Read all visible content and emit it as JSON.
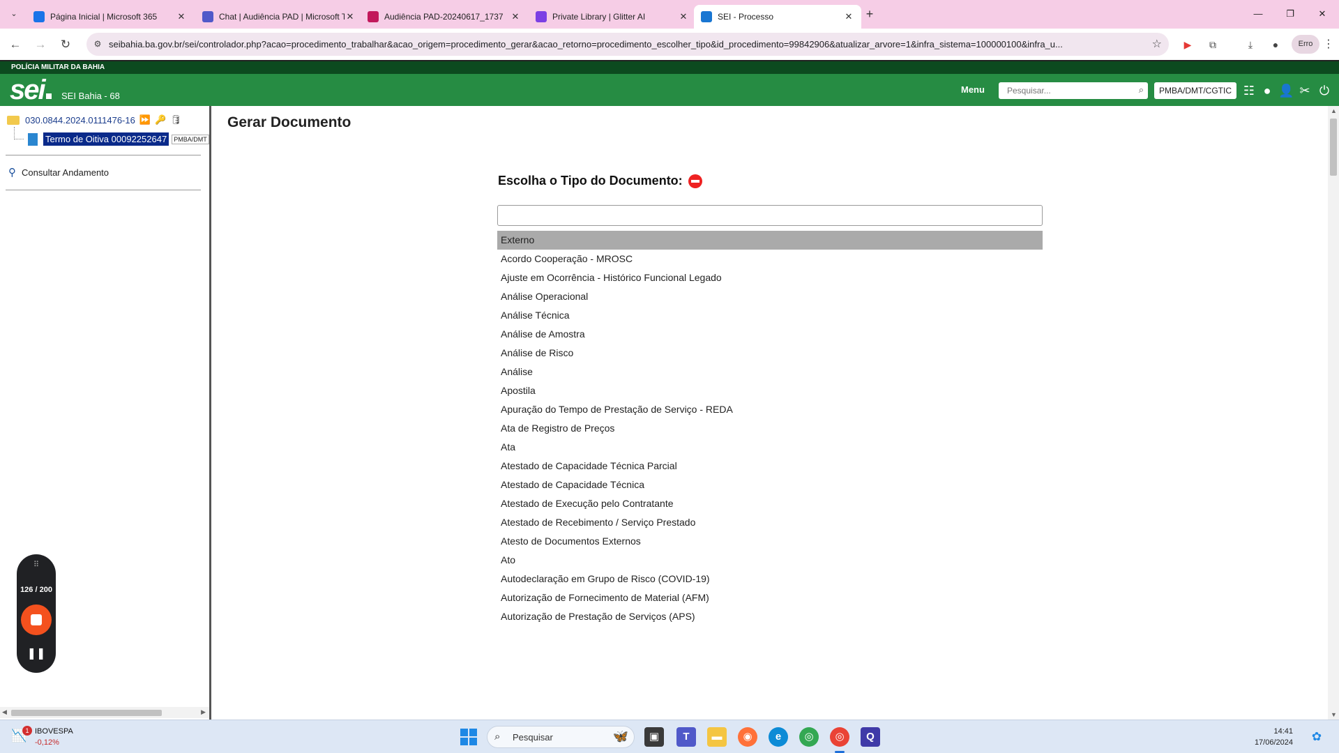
{
  "browser": {
    "tabs": [
      {
        "title": "Página Inicial | Microsoft 365",
        "color": "#1a73e8"
      },
      {
        "title": "Chat | Audiência PAD | Microsoft Teams",
        "color": "#5059c9"
      },
      {
        "title": "Audiência PAD-20240617_1737",
        "color": "#c2185b"
      },
      {
        "title": "Private Library | Glitter AI",
        "color": "#7b3fe4"
      },
      {
        "title": "SEI - Processo",
        "color": "#1976d2"
      }
    ],
    "url": "seibahia.ba.gov.br/sei/controlador.php?acao=procedimento_trabalhar&acao_origem=procedimento_gerar&acao_retorno=procedimento_escolher_tipo&id_procedimento=99842906&atualizar_arvore=1&infra_sistema=100000100&infra_u...",
    "profile_label": "Erro"
  },
  "sei": {
    "org": "POLÍCIA MILITAR DA BAHIA",
    "logo": "sei",
    "instance": "SEI Bahia - 68",
    "menu_label": "Menu",
    "search_placeholder": "Pesquisar...",
    "unit": "PMBA/DMT/CGTIC"
  },
  "tree": {
    "process_number": "030.0844.2024.0111476-16",
    "document_name": "Termo de Oitiva 00092252647",
    "document_unit": "PMBA/DMT",
    "consult_label": "Consultar Andamento"
  },
  "recorder": {
    "count": "126 / 200"
  },
  "main": {
    "page_title": "Gerar Documento",
    "choose_label": "Escolha o Tipo do Documento:",
    "filter_value": "",
    "document_types": [
      "Externo",
      "Acordo Cooperação - MROSC",
      "Ajuste em Ocorrência - Histórico Funcional Legado",
      "Análise Operacional",
      "Análise Técnica",
      "Análise de Amostra",
      "Análise de Risco",
      "Análise",
      "Apostila",
      "Apuração do Tempo de Prestação de Serviço  - REDA",
      "Ata de Registro de Preços",
      "Ata",
      "Atestado de Capacidade Técnica Parcial",
      "Atestado de Capacidade Técnica",
      "Atestado de Execução pelo Contratante",
      "Atestado de Recebimento / Serviço Prestado",
      "Atesto de Documentos Externos",
      "Ato",
      "Autodeclaração em Grupo de Risco (COVID-19)",
      "Autorização de Fornecimento de Material (AFM)",
      "Autorização de Prestação de Serviços (APS)"
    ],
    "selected_index": 0
  },
  "taskbar": {
    "stock_name": "IBOVESPA",
    "stock_change": "-0,12%",
    "stock_badge": "1",
    "search_label": "Pesquisar",
    "time": "14:41",
    "date": "17/06/2024"
  }
}
